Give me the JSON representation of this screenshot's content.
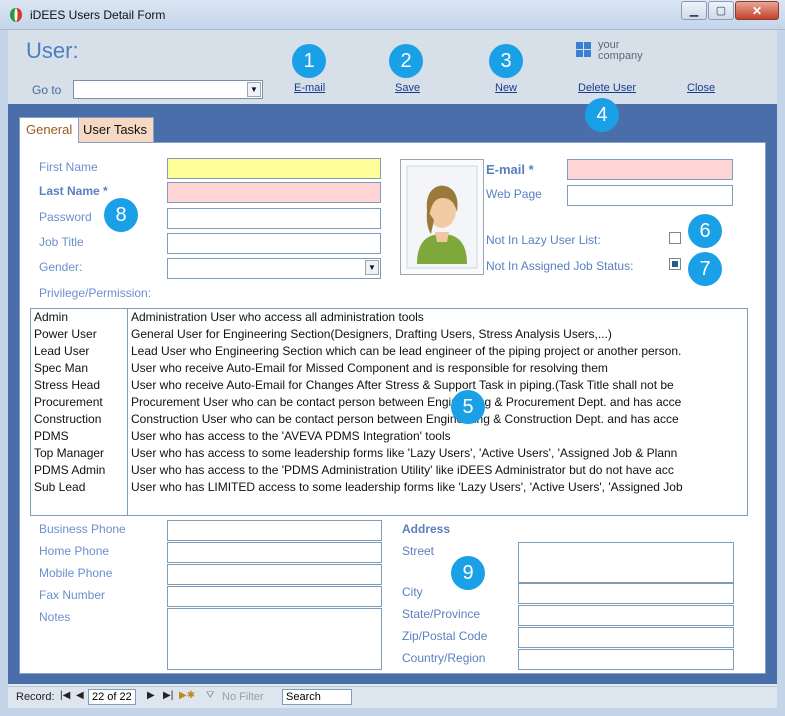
{
  "window": {
    "title": "iDEES Users Detail Form"
  },
  "header": {
    "title": "User:",
    "goto_label": "Go to",
    "goto_value": "",
    "logo_line1": "your",
    "logo_line2": "company",
    "actions": {
      "email": "E-mail",
      "save": "Save",
      "new": "New",
      "delete": "Delete User",
      "close": "Close"
    }
  },
  "callouts": [
    "1",
    "2",
    "3",
    "4",
    "5",
    "6",
    "7",
    "8",
    "9"
  ],
  "tabs": [
    {
      "label": "General",
      "active": true
    },
    {
      "label": "User Tasks",
      "active": false
    }
  ],
  "form": {
    "first_name_label": "First Name",
    "last_name_label": "Last Name *",
    "password_label": "Password",
    "job_title_label": "Job Title",
    "gender_label": "Gender:",
    "email_label": "E-mail  *",
    "web_page_label": "Web Page",
    "lazy_label": "Not In Lazy User List:",
    "lazy_checked": false,
    "assigned_label": "Not In Assigned Job Status:",
    "assigned_checked": true,
    "privilege_label": "Privilege/Permission:"
  },
  "privileges": [
    {
      "name": "Admin",
      "desc": "Administration User who access all administration tools"
    },
    {
      "name": "Power User",
      "desc": "General User for Engineering Section(Designers, Drafting Users, Stress Analysis Users,...)"
    },
    {
      "name": "Lead User",
      "desc": "Lead User who Engineering Section which can be lead engineer of the piping project or another person."
    },
    {
      "name": "Spec Man",
      "desc": "User who receive Auto-Email for Missed Component and is responsible for resolving them"
    },
    {
      "name": "Stress Head",
      "desc": "User who receive Auto-Email for Changes After Stress & Support Task in piping.(Task Title shall not be"
    },
    {
      "name": "Procurement",
      "desc": "Procurement User who can be contact person between Engineering & Procurement Dept. and has acce"
    },
    {
      "name": "Construction",
      "desc": "Construction User who can be contact person between Engineering & Construction Dept. and has acce"
    },
    {
      "name": "PDMS",
      "desc": "User who has access to the 'AVEVA PDMS Integration' tools"
    },
    {
      "name": "Top Manager",
      "desc": "User who has access to some leadership forms like 'Lazy Users', 'Active Users', 'Assigned Job & Plann"
    },
    {
      "name": "PDMS Admin",
      "desc": "User who has access to the 'PDMS Administration Utility' like iDEES Administrator but do not have acc"
    },
    {
      "name": "Sub Lead",
      "desc": "User who has LIMITED access to some leadership forms like 'Lazy Users', 'Active Users', 'Assigned Job"
    }
  ],
  "contact": {
    "business_phone": "Business Phone",
    "home_phone": "Home Phone",
    "mobile_phone": "Mobile Phone",
    "fax_number": "Fax Number",
    "notes": "Notes"
  },
  "address": {
    "heading": "Address",
    "street": "Street",
    "city": "City",
    "state": "State/Province",
    "zip": "Zip/Postal Code",
    "country": "Country/Region"
  },
  "statusbar": {
    "record_label": "Record:",
    "record_value": "22 of 22",
    "filter_label": "No Filter",
    "search_label": "Search"
  }
}
